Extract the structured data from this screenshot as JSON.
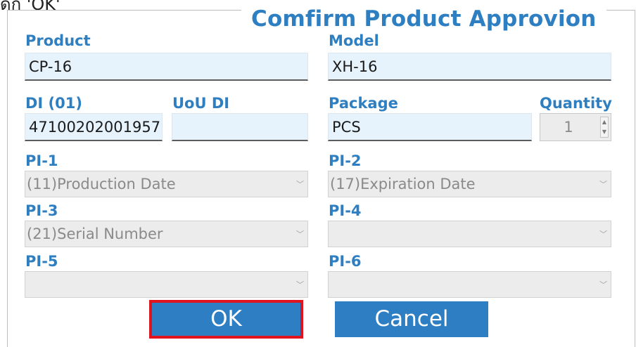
{
  "top_note": "ดัก 'OK'",
  "dialog": {
    "title": "Comfirm Product Approvion",
    "product": {
      "label": "Product",
      "value": "CP-16"
    },
    "model": {
      "label": "Model",
      "value": "XH-16"
    },
    "di": {
      "label": "DI (01)",
      "value": "47100202001957"
    },
    "uou_di": {
      "label": "UoU DI",
      "value": ""
    },
    "package": {
      "label": "Package",
      "value": "PCS"
    },
    "quantity": {
      "label": "Quantity",
      "value": "1"
    },
    "pi": [
      {
        "label": "PI-1",
        "value": "(11)Production Date"
      },
      {
        "label": "PI-2",
        "value": "(17)Expiration Date"
      },
      {
        "label": "PI-3",
        "value": "(21)Serial Number"
      },
      {
        "label": "PI-4",
        "value": ""
      },
      {
        "label": "PI-5",
        "value": ""
      },
      {
        "label": "PI-6",
        "value": ""
      }
    ],
    "ok_label": "OK",
    "cancel_label": "Cancel"
  },
  "colors": {
    "accent": "#2e7fc1",
    "button": "#2d7ec2",
    "highlight_border": "#e0141e",
    "textbox_bg": "#e6f3fc",
    "combo_bg": "#ececec"
  }
}
